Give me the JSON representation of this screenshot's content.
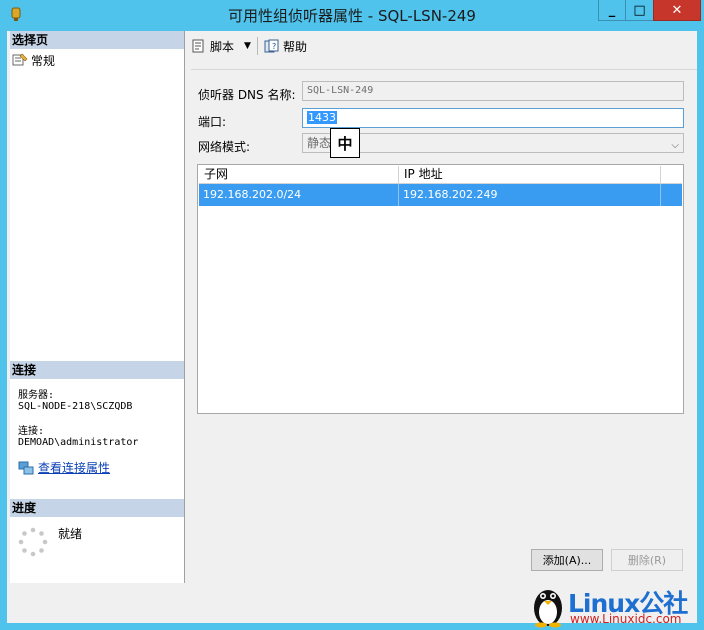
{
  "window": {
    "title": "可用性组侦听器属性 - SQL-LSN-249",
    "controls": {
      "minimize": "_",
      "maximize": "□",
      "close": "✕"
    }
  },
  "left": {
    "select_page_header": "选择页",
    "page_item": "常规",
    "connection_header": "连接",
    "server_label": "服务器:",
    "server_value": "SQL-NODE-218\\SCZQDB",
    "connection_label": "连接:",
    "connection_value": "DEMOAD\\administrator",
    "view_link": "查看连接属性",
    "progress_header": "进度",
    "progress_status": "就绪"
  },
  "toolbar": {
    "script_label": "脚本",
    "help_label": "帮助"
  },
  "form": {
    "dns_label": "侦听器 DNS 名称:",
    "dns_value": "SQL-LSN-249",
    "port_label": "端口:",
    "port_value": "1433",
    "mode_label": "网络模式:",
    "mode_value": "静态",
    "ime_char": "中"
  },
  "grid": {
    "headers": [
      "子网",
      "IP 地址"
    ],
    "rows": [
      {
        "subnet": "192.168.202.0/24",
        "ip": "192.168.202.249"
      }
    ]
  },
  "buttons": {
    "add": "添加(A)...",
    "remove": "删除(R)"
  },
  "watermark": {
    "brand": "Linux公社",
    "url": "www.Linuxidc.com"
  },
  "colors": {
    "window_frame": "#4fc3ec",
    "selection": "#3a9cf0",
    "close_button": "#c7362b",
    "link": "#0b3fb6"
  }
}
